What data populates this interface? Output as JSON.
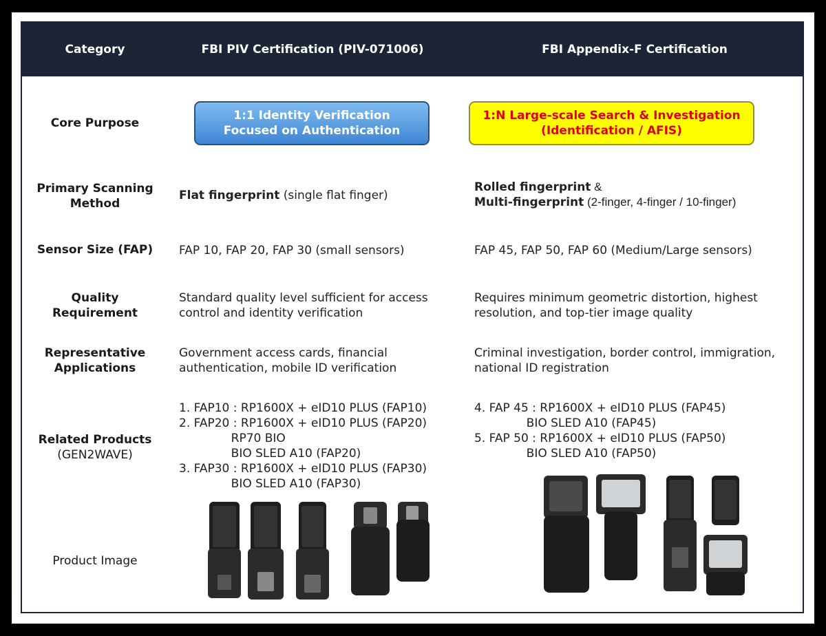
{
  "header": {
    "col1": "Category",
    "col2": "FBI PIV Certification (PIV-071006)",
    "col3": "FBI Appendix-F Certification"
  },
  "rows": {
    "core_purpose": {
      "label": "Core Purpose",
      "piv_line1": "1:1 Identity Verification",
      "piv_line2": "Focused on Authentication",
      "appf_line1": "1:N Large-scale Search & Investigation",
      "appf_line2": "(Identification / AFIS)"
    },
    "scanning": {
      "label_line1": "Primary Scanning",
      "label_line2": "Method",
      "piv_bold": "Flat fingerprint",
      "piv_rest": " (single flat finger)",
      "appf_bold1": "Rolled fingerprint",
      "appf_rest1": " &",
      "appf_bold2": "Multi-fingerprint",
      "appf_rest2": " (2-finger, 4-finger / 10-finger)"
    },
    "sensor": {
      "label": "Sensor Size (FAP)",
      "piv": "FAP 10, FAP 20, FAP 30 (small sensors)",
      "appf": "FAP 45, FAP 50, FAP 60 (Medium/Large sensors)"
    },
    "quality": {
      "label_line1": "Quality",
      "label_line2": "Requirement",
      "piv_line1": "Standard quality level sufficient for access",
      "piv_line2": "control and identity verification",
      "appf_line1": "Requires minimum geometric distortion, highest",
      "appf_line2": "resolution, and top-tier image quality"
    },
    "applications": {
      "label_line1": "Representative",
      "label_line2": "Applications",
      "piv_line1": "Government access cards, financial",
      "piv_line2": "authentication, mobile ID verification",
      "appf_line1": "Criminal investigation, border control, immigration,",
      "appf_line2": "national ID registration"
    },
    "products": {
      "label_line1": "Related Products",
      "label_line2": "(GEN2WAVE)",
      "piv_lines": [
        "1. FAP10 : RP1600X + eID10 PLUS (FAP10)",
        "2. FAP20 : RP1600X + eID10 PLUS (FAP20)",
        "              RP70 BIO",
        "              BIO SLED A10 (FAP20)",
        "3. FAP30 : RP1600X + eID10 PLUS (FAP30)",
        "              BIO SLED A10 (FAP30)"
      ],
      "appf_lines": [
        "4. FAP 45 : RP1600X + eID10 PLUS (FAP45)",
        "              BIO SLED A10 (FAP45)",
        "5. FAP 50 : RP1600X + eID10 PLUS (FAP50)",
        "              BIO SLED A10 (FAP50)"
      ]
    },
    "image": {
      "label": "Product Image"
    }
  },
  "colors": {
    "header_bg": "#1b2536",
    "blue_pill": "#4a90d9",
    "yellow_pill": "#ffff00",
    "red_text": "#e00000"
  }
}
